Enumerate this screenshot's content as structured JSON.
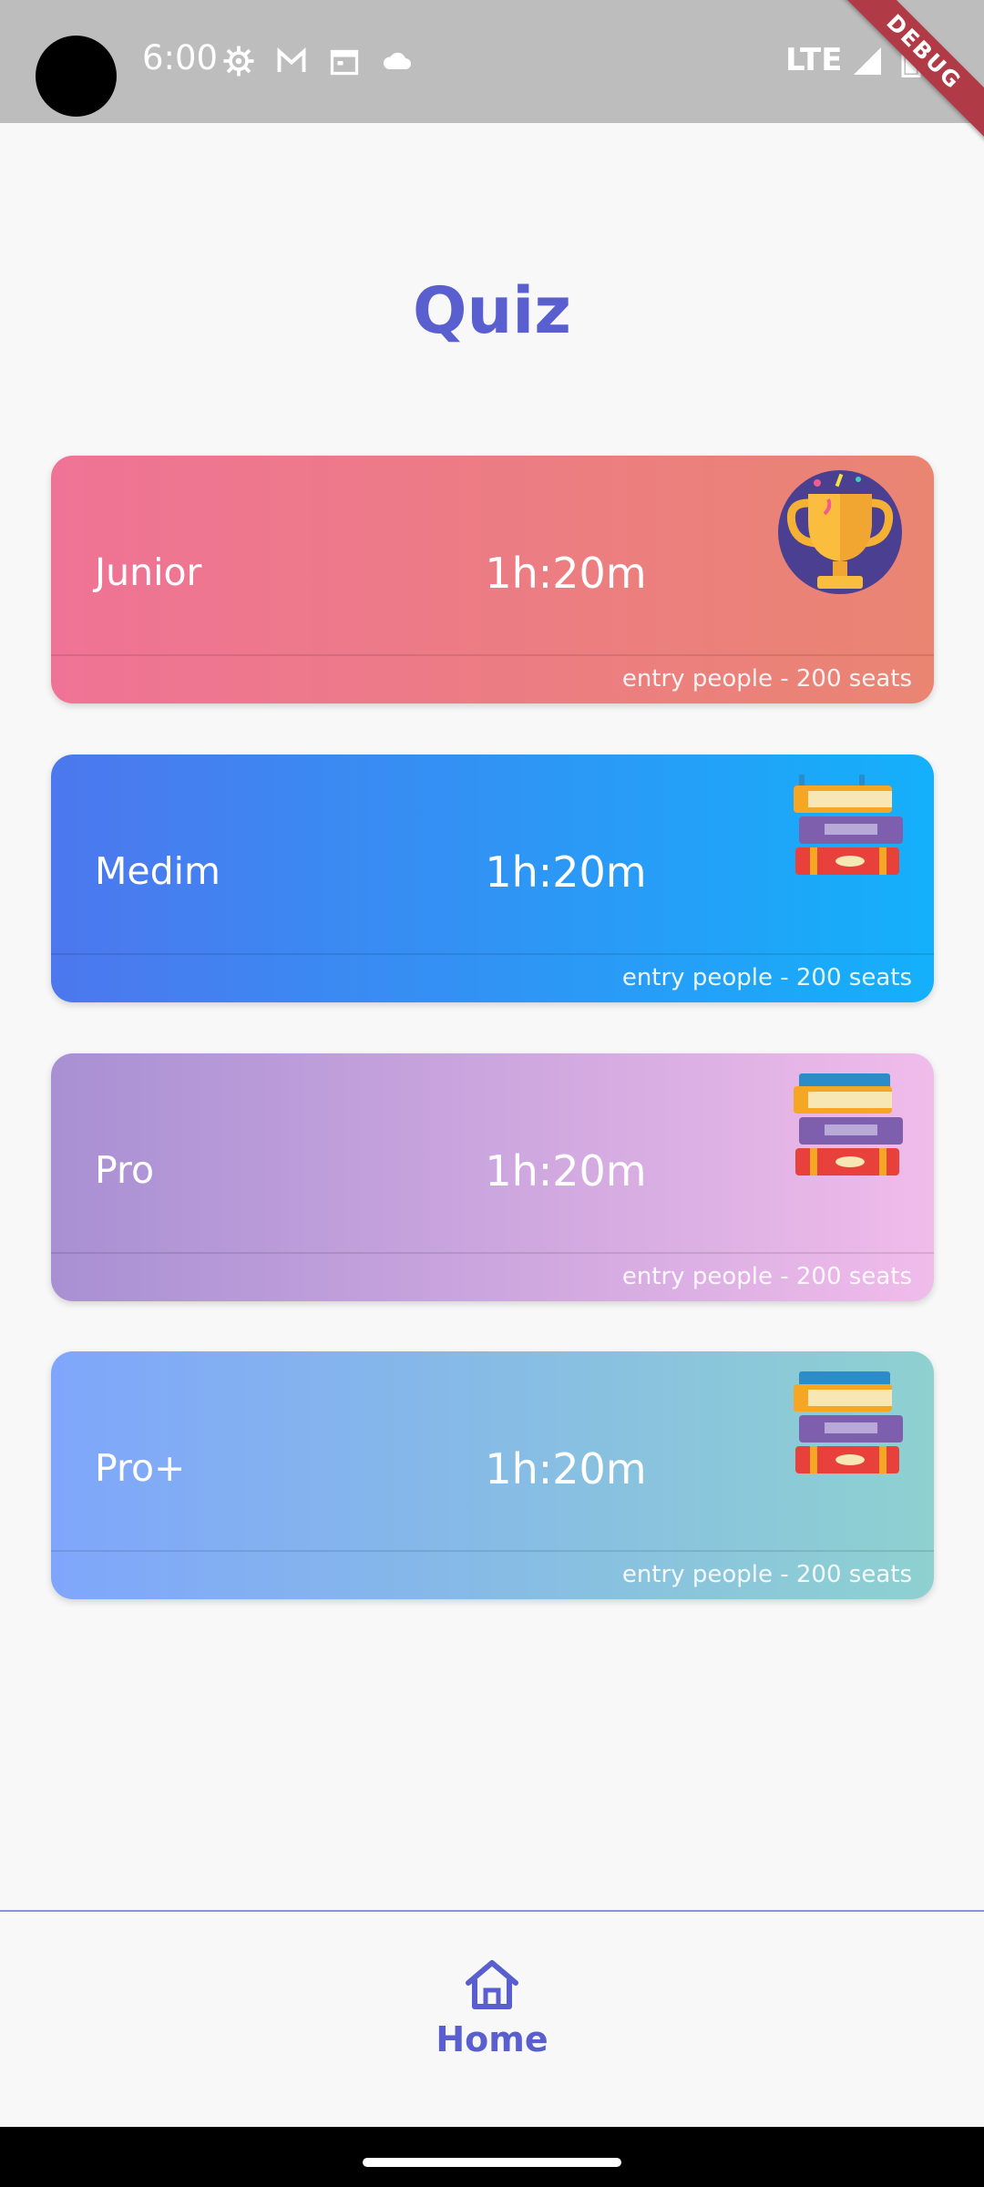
{
  "status_bar": {
    "time": "6:00",
    "network": "LTE",
    "icons": [
      "settings-gear-icon",
      "gmail-icon",
      "calendar-icon",
      "cloud-icon",
      "signal-icon",
      "battery-icon"
    ]
  },
  "debug_banner": "DEBUG",
  "page": {
    "title": "Quiz"
  },
  "cards": [
    {
      "level": "Junior",
      "duration": "1h:20m",
      "seats": "entry people - 200 seats",
      "art": "trophy-icon"
    },
    {
      "level": "Medim",
      "duration": "1h:20m",
      "seats": "entry people - 200 seats",
      "art": "books-icon"
    },
    {
      "level": "Pro",
      "duration": "1h:20m",
      "seats": "entry people - 200 seats",
      "art": "books-icon"
    },
    {
      "level": "Pro+",
      "duration": "1h:20m",
      "seats": "entry people - 200 seats",
      "art": "books-icon"
    }
  ],
  "bottom_nav": {
    "home_label": "Home",
    "accent": "#5a5fcf"
  }
}
